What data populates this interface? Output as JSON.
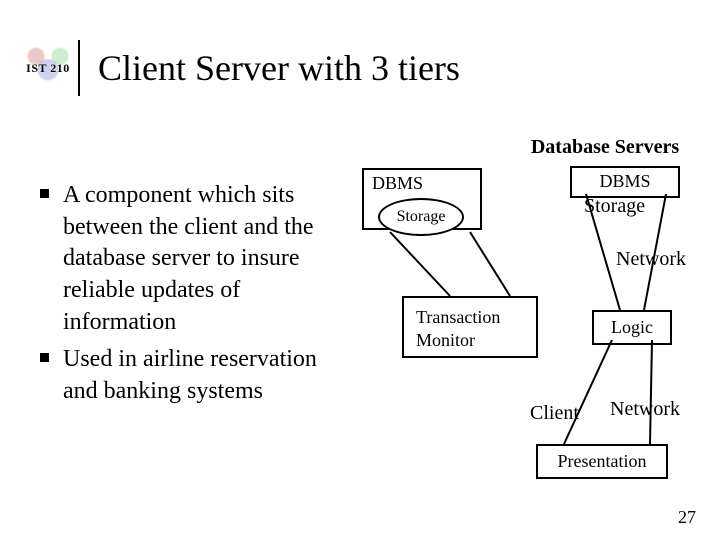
{
  "course_code": "IST 210",
  "title": "Client Server with 3 tiers",
  "bullets": [
    "A component which sits between the client and the database server to insure reliable updates of information",
    "Used in airline reservation and banking systems"
  ],
  "diagram": {
    "section_header": "Database Servers",
    "dbms_left": "DBMS",
    "dbms_right": "DBMS",
    "storage_left": "Storage",
    "storage_right": "Storage",
    "network_top": "Network",
    "transaction_monitor": "Transaction Monitor",
    "logic": "Logic",
    "client_label": "Client",
    "network_bottom": "Network",
    "presentation": "Presentation"
  },
  "slide_number": "27"
}
